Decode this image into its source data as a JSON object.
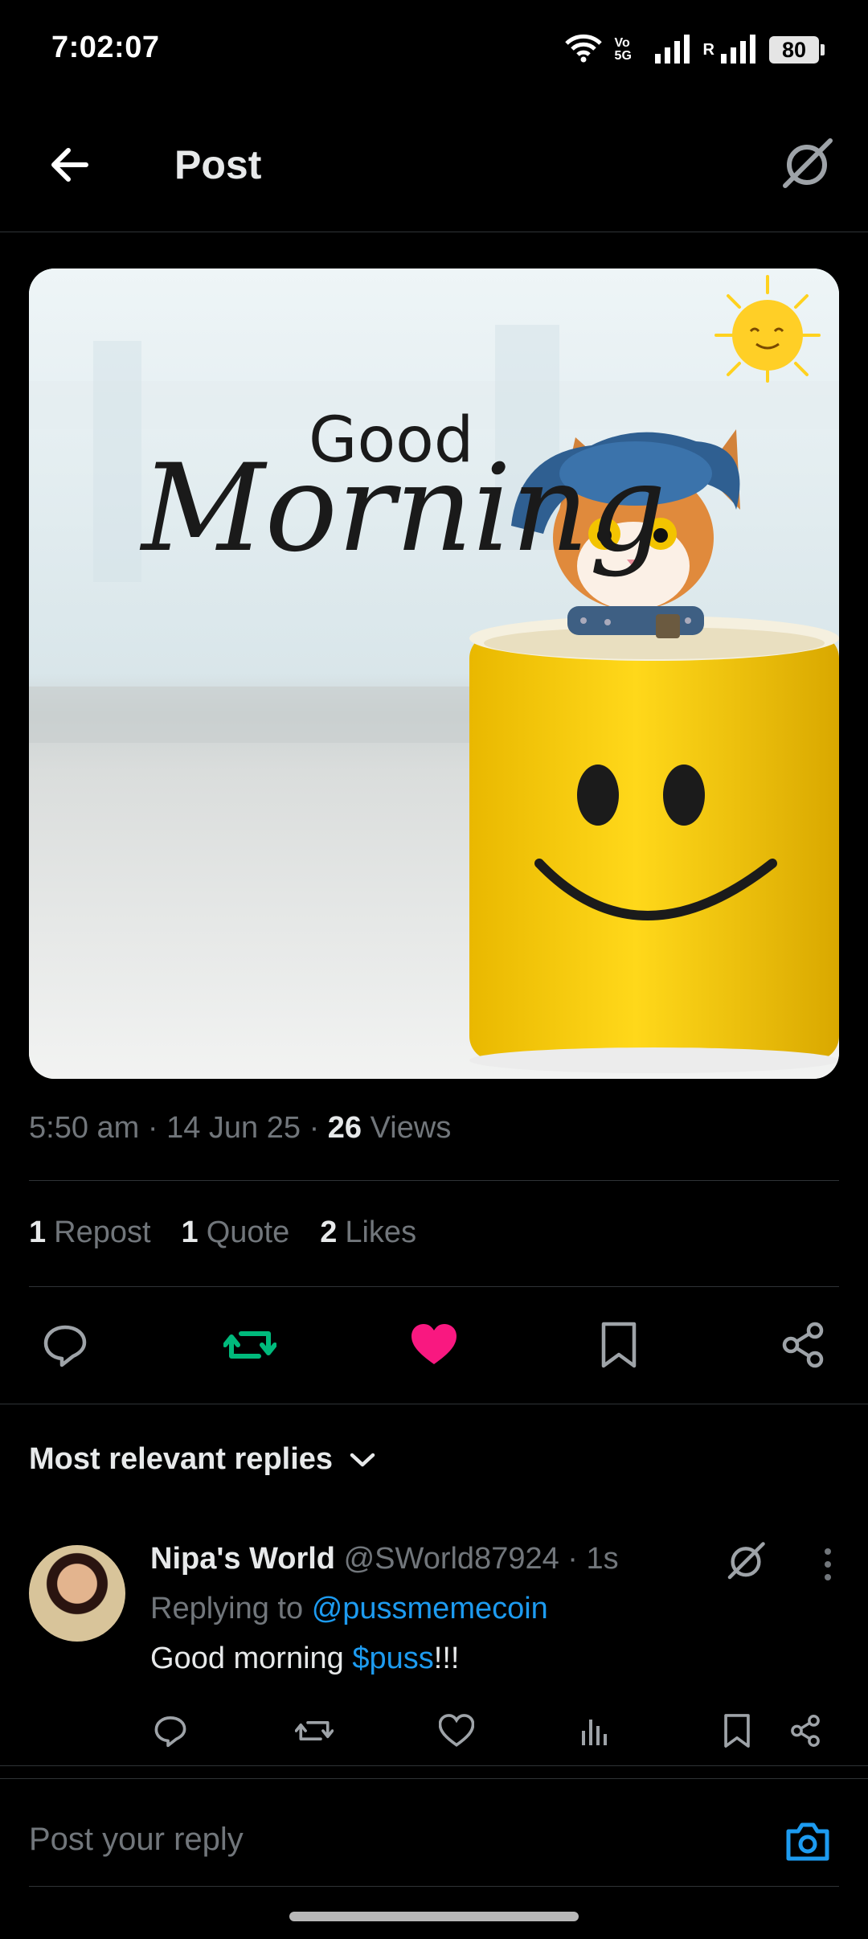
{
  "status_bar": {
    "time": "7:02:07",
    "network_label": "Vo 5G",
    "roaming": "R",
    "battery": "80"
  },
  "header": {
    "title": "Post",
    "back_icon": "arrow-left-icon",
    "grok_icon": "grok-icon"
  },
  "media": {
    "headline_small": "Good",
    "headline_large": "Morning"
  },
  "post_meta": {
    "time": "5:50 am",
    "date": "14 Jun 25",
    "views_count": "26",
    "views_label": "Views"
  },
  "engagement": {
    "reposts_count": "1",
    "reposts_label": "Repost",
    "quotes_count": "1",
    "quotes_label": "Quote",
    "likes_count": "2",
    "likes_label": "Likes"
  },
  "colors": {
    "repost_active": "#00ba7c",
    "like_active": "#f91880",
    "link": "#1d9bf0",
    "muted": "#71767b"
  },
  "replies_sort": {
    "label": "Most relevant replies"
  },
  "reply": {
    "display_name": "Nipa's World",
    "handle": "@SWorld87924",
    "time": "1s",
    "replying_prefix": "Replying to",
    "replying_to": "@pussmemecoin",
    "text_before": "Good morning ",
    "cashtag": "$puss",
    "text_after": "!!!"
  },
  "composer": {
    "placeholder": "Post your reply"
  }
}
